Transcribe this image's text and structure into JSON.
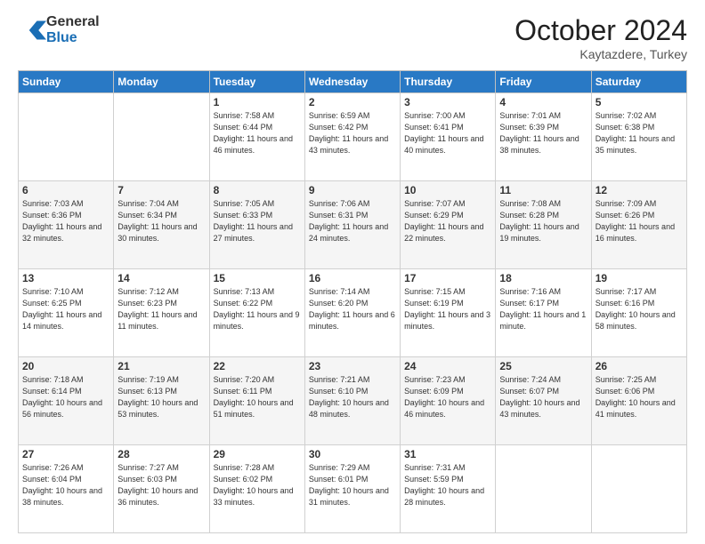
{
  "header": {
    "logo_general": "General",
    "logo_blue": "Blue",
    "month": "October 2024",
    "location": "Kaytazdere, Turkey"
  },
  "weekdays": [
    "Sunday",
    "Monday",
    "Tuesday",
    "Wednesday",
    "Thursday",
    "Friday",
    "Saturday"
  ],
  "weeks": [
    [
      null,
      null,
      {
        "day": 1,
        "sunrise": "7:58 AM",
        "sunset": "6:44 PM",
        "daylight": "11 hours and 46 minutes."
      },
      {
        "day": 2,
        "sunrise": "6:59 AM",
        "sunset": "6:42 PM",
        "daylight": "11 hours and 43 minutes."
      },
      {
        "day": 3,
        "sunrise": "7:00 AM",
        "sunset": "6:41 PM",
        "daylight": "11 hours and 40 minutes."
      },
      {
        "day": 4,
        "sunrise": "7:01 AM",
        "sunset": "6:39 PM",
        "daylight": "11 hours and 38 minutes."
      },
      {
        "day": 5,
        "sunrise": "7:02 AM",
        "sunset": "6:38 PM",
        "daylight": "11 hours and 35 minutes."
      }
    ],
    [
      {
        "day": 6,
        "sunrise": "7:03 AM",
        "sunset": "6:36 PM",
        "daylight": "11 hours and 32 minutes."
      },
      {
        "day": 7,
        "sunrise": "7:04 AM",
        "sunset": "6:34 PM",
        "daylight": "11 hours and 30 minutes."
      },
      {
        "day": 8,
        "sunrise": "7:05 AM",
        "sunset": "6:33 PM",
        "daylight": "11 hours and 27 minutes."
      },
      {
        "day": 9,
        "sunrise": "7:06 AM",
        "sunset": "6:31 PM",
        "daylight": "11 hours and 24 minutes."
      },
      {
        "day": 10,
        "sunrise": "7:07 AM",
        "sunset": "6:29 PM",
        "daylight": "11 hours and 22 minutes."
      },
      {
        "day": 11,
        "sunrise": "7:08 AM",
        "sunset": "6:28 PM",
        "daylight": "11 hours and 19 minutes."
      },
      {
        "day": 12,
        "sunrise": "7:09 AM",
        "sunset": "6:26 PM",
        "daylight": "11 hours and 16 minutes."
      }
    ],
    [
      {
        "day": 13,
        "sunrise": "7:10 AM",
        "sunset": "6:25 PM",
        "daylight": "11 hours and 14 minutes."
      },
      {
        "day": 14,
        "sunrise": "7:12 AM",
        "sunset": "6:23 PM",
        "daylight": "11 hours and 11 minutes."
      },
      {
        "day": 15,
        "sunrise": "7:13 AM",
        "sunset": "6:22 PM",
        "daylight": "11 hours and 9 minutes."
      },
      {
        "day": 16,
        "sunrise": "7:14 AM",
        "sunset": "6:20 PM",
        "daylight": "11 hours and 6 minutes."
      },
      {
        "day": 17,
        "sunrise": "7:15 AM",
        "sunset": "6:19 PM",
        "daylight": "11 hours and 3 minutes."
      },
      {
        "day": 18,
        "sunrise": "7:16 AM",
        "sunset": "6:17 PM",
        "daylight": "11 hours and 1 minute."
      },
      {
        "day": 19,
        "sunrise": "7:17 AM",
        "sunset": "6:16 PM",
        "daylight": "10 hours and 58 minutes."
      }
    ],
    [
      {
        "day": 20,
        "sunrise": "7:18 AM",
        "sunset": "6:14 PM",
        "daylight": "10 hours and 56 minutes."
      },
      {
        "day": 21,
        "sunrise": "7:19 AM",
        "sunset": "6:13 PM",
        "daylight": "10 hours and 53 minutes."
      },
      {
        "day": 22,
        "sunrise": "7:20 AM",
        "sunset": "6:11 PM",
        "daylight": "10 hours and 51 minutes."
      },
      {
        "day": 23,
        "sunrise": "7:21 AM",
        "sunset": "6:10 PM",
        "daylight": "10 hours and 48 minutes."
      },
      {
        "day": 24,
        "sunrise": "7:23 AM",
        "sunset": "6:09 PM",
        "daylight": "10 hours and 46 minutes."
      },
      {
        "day": 25,
        "sunrise": "7:24 AM",
        "sunset": "6:07 PM",
        "daylight": "10 hours and 43 minutes."
      },
      {
        "day": 26,
        "sunrise": "7:25 AM",
        "sunset": "6:06 PM",
        "daylight": "10 hours and 41 minutes."
      }
    ],
    [
      {
        "day": 27,
        "sunrise": "7:26 AM",
        "sunset": "6:04 PM",
        "daylight": "10 hours and 38 minutes."
      },
      {
        "day": 28,
        "sunrise": "7:27 AM",
        "sunset": "6:03 PM",
        "daylight": "10 hours and 36 minutes."
      },
      {
        "day": 29,
        "sunrise": "7:28 AM",
        "sunset": "6:02 PM",
        "daylight": "10 hours and 33 minutes."
      },
      {
        "day": 30,
        "sunrise": "7:29 AM",
        "sunset": "6:01 PM",
        "daylight": "10 hours and 31 minutes."
      },
      {
        "day": 31,
        "sunrise": "7:31 AM",
        "sunset": "5:59 PM",
        "daylight": "10 hours and 28 minutes."
      },
      null,
      null
    ]
  ]
}
